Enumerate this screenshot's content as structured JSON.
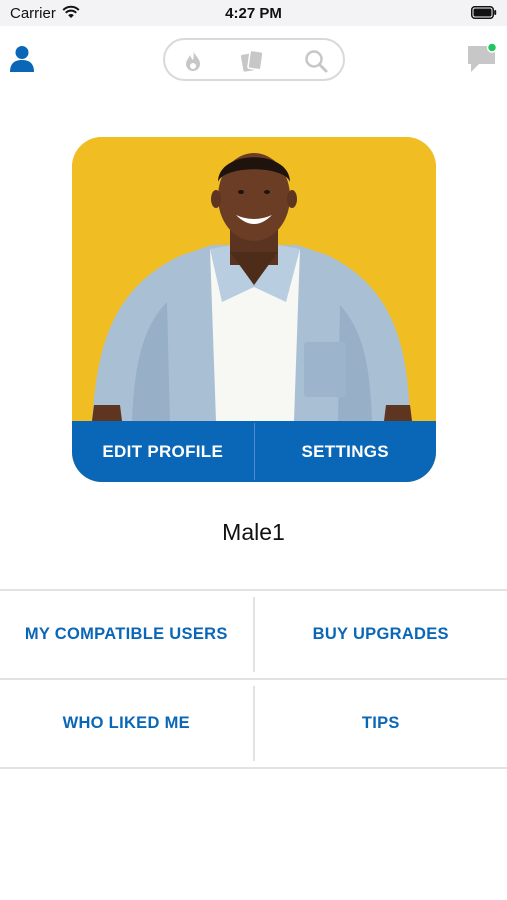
{
  "status_bar": {
    "carrier": "Carrier",
    "time": "4:27 PM"
  },
  "nav": {
    "profile_icon": "user-icon",
    "tabs": [
      {
        "icon": "flame-icon"
      },
      {
        "icon": "cards-icon"
      },
      {
        "icon": "search-icon"
      }
    ],
    "messages_icon": "chat-bubble-icon",
    "unread_indicator_color": "#22c55e"
  },
  "profile": {
    "photo": "profile-photo",
    "edit_label": "EDIT PROFILE",
    "settings_label": "SETTINGS",
    "username": "Male1"
  },
  "menu": {
    "compatible_users": "MY COMPATIBLE USERS",
    "buy_upgrades": "BUY UPGRADES",
    "who_liked_me": "WHO LIKED ME",
    "tips": "TIPS"
  },
  "colors": {
    "accent": "#0a67b7",
    "photo_background": "#f0bd22"
  }
}
